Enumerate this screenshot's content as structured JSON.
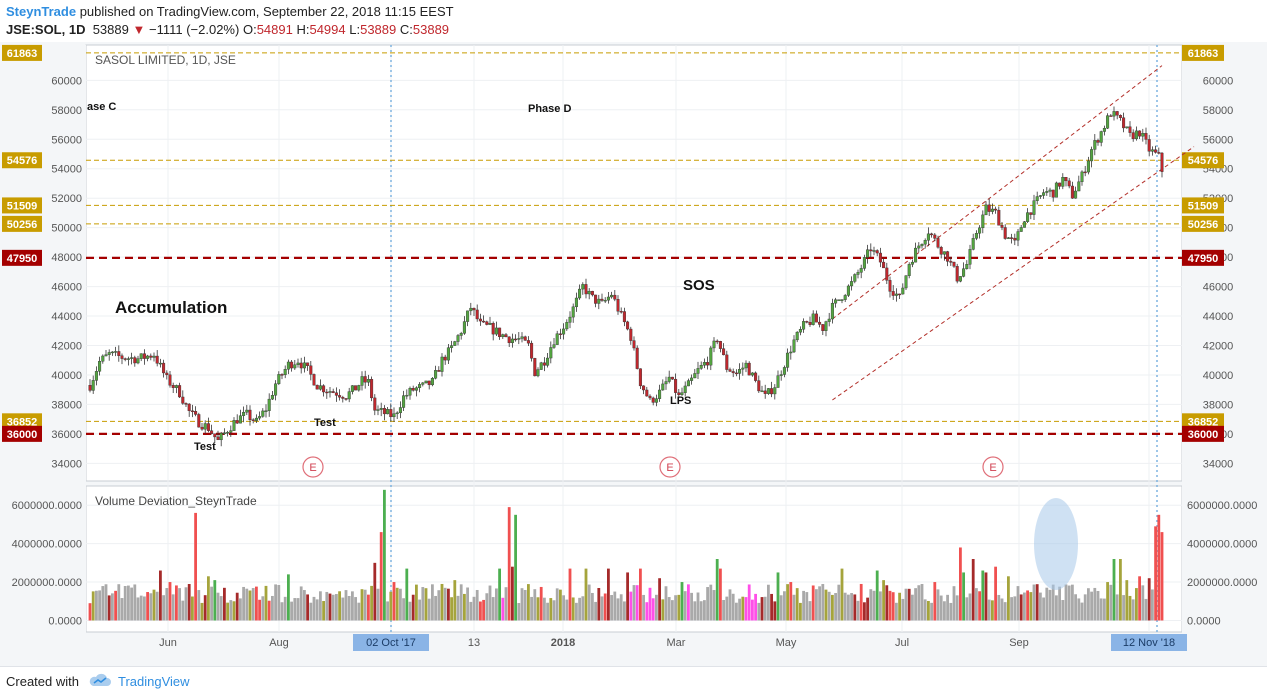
{
  "header": {
    "author": "SteynTrade",
    "published": " published on TradingView.com, September 22, 2018 11:15 EEST",
    "symbol": "JSE:SOL, 1D",
    "last": "53889",
    "change": "−1111 (−2.02%)",
    "o_label": "O:",
    "o_val": "54891",
    "h_label": "H:",
    "h_val": "54994",
    "l_label": "L:",
    "l_val": "53889",
    "c_label": "C:",
    "c_val": "53889"
  },
  "footer": {
    "created": "Created with",
    "brand": "TradingView"
  },
  "colors": {
    "up": "#53a540",
    "down": "#c0272d",
    "gold": "#c89c00",
    "darkred": "#a40000",
    "vol_grey": "#a9a9a9",
    "vol_olive": "#a5a43c",
    "vol_green": "#4caf50",
    "vol_darkred": "#a52a2a",
    "vol_red": "#f05050",
    "vol_pink": "#ff4fe8"
  },
  "chart_data": [
    {
      "type": "candlestick",
      "title": "SASOL LIMITED, 1D, JSE",
      "ylim": [
        32800,
        62400
      ],
      "y_ticks": [
        34000,
        36000,
        38000,
        40000,
        42000,
        44000,
        46000,
        48000,
        50000,
        52000,
        54000,
        56000,
        58000,
        60000
      ],
      "x_ticks": [
        "Jun",
        "Aug",
        "02 Oct '17",
        "13",
        "2018",
        "Mar",
        "May",
        "Jul",
        "Sep",
        "12 Nov '18"
      ],
      "x_ticks_highlighted": [
        "02 Oct '17",
        "12 Nov '18"
      ],
      "horizontal_levels": [
        {
          "value": 61863,
          "style": "gold-dashed"
        },
        {
          "value": 54576,
          "style": "gold-dashed"
        },
        {
          "value": 51509,
          "style": "gold-dashed"
        },
        {
          "value": 50256,
          "style": "gold-dashed"
        },
        {
          "value": 47950,
          "style": "darkred-thick-dashed"
        },
        {
          "value": 36852,
          "style": "gold-dashed"
        },
        {
          "value": 36000,
          "style": "darkred-thick-dashed"
        }
      ],
      "annotations": [
        {
          "text": "ase C"
        },
        {
          "text": "Phase D"
        },
        {
          "text": "Accumulation"
        },
        {
          "text": "SOS"
        },
        {
          "text": "LPS"
        },
        {
          "text": "Test"
        },
        {
          "text": "Test"
        }
      ],
      "event_markers": [
        "E",
        "E",
        "E"
      ],
      "price_path": [
        [
          0,
          39300
        ],
        [
          3,
          40900
        ],
        [
          6,
          41400
        ],
        [
          10,
          41200
        ],
        [
          15,
          41100
        ],
        [
          20,
          41400
        ],
        [
          24,
          39700
        ],
        [
          28,
          38800
        ],
        [
          31,
          37500
        ],
        [
          34,
          36800
        ],
        [
          37,
          36400
        ],
        [
          40,
          35500
        ],
        [
          43,
          36300
        ],
        [
          46,
          37000
        ],
        [
          49,
          37300
        ],
        [
          52,
          36800
        ],
        [
          55,
          37700
        ],
        [
          58,
          39400
        ],
        [
          62,
          40700
        ],
        [
          65,
          41000
        ],
        [
          68,
          40300
        ],
        [
          71,
          39300
        ],
        [
          74,
          39000
        ],
        [
          77,
          38800
        ],
        [
          80,
          38600
        ],
        [
          83,
          39100
        ],
        [
          85,
          39600
        ],
        [
          87,
          39500
        ],
        [
          89,
          37600
        ],
        [
          92,
          37400
        ],
        [
          95,
          37200
        ],
        [
          98,
          38500
        ],
        [
          101,
          39000
        ],
        [
          104,
          39200
        ],
        [
          107,
          39500
        ],
        [
          110,
          41000
        ],
        [
          113,
          41800
        ],
        [
          116,
          43000
        ],
        [
          119,
          44600
        ],
        [
          122,
          43400
        ],
        [
          125,
          43200
        ],
        [
          128,
          42800
        ],
        [
          131,
          42500
        ],
        [
          134,
          42400
        ],
        [
          137,
          42000
        ],
        [
          139,
          40200
        ],
        [
          142,
          41000
        ],
        [
          145,
          42400
        ],
        [
          148,
          43300
        ],
        [
          151,
          44500
        ],
        [
          154,
          46000
        ],
        [
          157,
          45200
        ],
        [
          160,
          44800
        ],
        [
          163,
          45500
        ],
        [
          166,
          44000
        ],
        [
          169,
          42600
        ],
        [
          172,
          39500
        ],
        [
          175,
          38200
        ],
        [
          178,
          38800
        ],
        [
          181,
          39800
        ],
        [
          184,
          38500
        ],
        [
          187,
          39300
        ],
        [
          190,
          40300
        ],
        [
          193,
          41000
        ],
        [
          196,
          42500
        ],
        [
          199,
          40500
        ],
        [
          202,
          40100
        ],
        [
          205,
          40700
        ],
        [
          208,
          39500
        ],
        [
          211,
          38500
        ],
        [
          214,
          39300
        ],
        [
          217,
          40800
        ],
        [
          220,
          42300
        ],
        [
          223,
          43300
        ],
        [
          226,
          43800
        ],
        [
          229,
          43200
        ],
        [
          232,
          44600
        ],
        [
          235,
          45400
        ],
        [
          238,
          46200
        ],
        [
          241,
          47300
        ],
        [
          244,
          48600
        ],
        [
          247,
          47700
        ],
        [
          250,
          46000
        ],
        [
          253,
          45200
        ],
        [
          256,
          47600
        ],
        [
          259,
          48800
        ],
        [
          262,
          49800
        ],
        [
          265,
          48800
        ],
        [
          268,
          48000
        ],
        [
          271,
          46600
        ],
        [
          274,
          47500
        ],
        [
          277,
          49700
        ],
        [
          280,
          51300
        ],
        [
          283,
          51000
        ],
        [
          286,
          49500
        ],
        [
          289,
          48900
        ],
        [
          292,
          50700
        ],
        [
          295,
          51500
        ],
        [
          298,
          52400
        ],
        [
          301,
          52400
        ],
        [
          304,
          53300
        ],
        [
          307,
          52200
        ],
        [
          310,
          53500
        ],
        [
          313,
          55300
        ],
        [
          316,
          56500
        ],
        [
          319,
          57800
        ],
        [
          322,
          57200
        ],
        [
          325,
          56200
        ],
        [
          328,
          56500
        ],
        [
          331,
          55300
        ],
        [
          334,
          54800
        ],
        [
          335,
          53889
        ]
      ],
      "channel": {
        "upper": [
          [
            232,
            43800
          ],
          [
            335,
            61000
          ]
        ],
        "lower": [
          [
            232,
            38300
          ],
          [
            345,
            55500
          ]
        ]
      }
    },
    {
      "type": "bar",
      "title": "Volume Deviation_SteynTrade",
      "ylim": [
        -600000,
        7000000
      ],
      "y_ticks": [
        0,
        2000000,
        4000000,
        6000000
      ],
      "y_tick_labels": [
        "0.0000",
        "2000000.0000",
        "4000000.0000",
        "6000000.0000"
      ],
      "spikes": [
        [
          22,
          2600000,
          "vol_darkred"
        ],
        [
          25,
          2000000,
          "vol_red"
        ],
        [
          33,
          5600000,
          "vol_red"
        ],
        [
          37,
          2300000,
          "vol_olive"
        ],
        [
          39,
          2100000,
          "vol_green"
        ],
        [
          42,
          1700000,
          "vol_darkred"
        ],
        [
          55,
          1800000,
          "vol_olive"
        ],
        [
          62,
          2400000,
          "vol_green"
        ],
        [
          75,
          1400000,
          "vol_darkred"
        ],
        [
          88,
          1800000,
          "vol_olive"
        ],
        [
          89,
          3000000,
          "vol_darkred"
        ],
        [
          91,
          4600000,
          "vol_red"
        ],
        [
          92,
          6800000,
          "vol_green"
        ],
        [
          95,
          2000000,
          "vol_red"
        ],
        [
          99,
          2700000,
          "vol_green"
        ],
        [
          110,
          1900000,
          "vol_olive"
        ],
        [
          114,
          2100000,
          "vol_olive"
        ],
        [
          128,
          2700000,
          "vol_green"
        ],
        [
          131,
          5900000,
          "vol_red"
        ],
        [
          133,
          5500000,
          "vol_green"
        ],
        [
          132,
          2800000,
          "vol_darkred"
        ],
        [
          150,
          2700000,
          "vol_red"
        ],
        [
          155,
          2700000,
          "vol_olive"
        ],
        [
          162,
          2700000,
          "vol_darkred"
        ],
        [
          168,
          2500000,
          "vol_darkred"
        ],
        [
          172,
          2700000,
          "vol_red"
        ],
        [
          178,
          2200000,
          "vol_darkred"
        ],
        [
          185,
          2000000,
          "vol_green"
        ],
        [
          196,
          3200000,
          "vol_green"
        ],
        [
          197,
          2700000,
          "vol_red"
        ],
        [
          215,
          2500000,
          "vol_green"
        ],
        [
          219,
          2000000,
          "vol_red"
        ],
        [
          235,
          2700000,
          "vol_olive"
        ],
        [
          241,
          1900000,
          "vol_red"
        ],
        [
          246,
          2600000,
          "vol_green"
        ],
        [
          248,
          2100000,
          "vol_olive"
        ],
        [
          264,
          2000000,
          "vol_red"
        ],
        [
          272,
          3800000,
          "vol_red"
        ],
        [
          273,
          2500000,
          "vol_green"
        ],
        [
          276,
          3200000,
          "vol_darkred"
        ],
        [
          279,
          2600000,
          "vol_green"
        ],
        [
          280,
          2500000,
          "vol_darkred"
        ],
        [
          283,
          2800000,
          "vol_red"
        ],
        [
          287,
          2300000,
          "vol_olive"
        ],
        [
          318,
          2000000,
          "vol_olive"
        ],
        [
          320,
          3200000,
          "vol_green"
        ],
        [
          322,
          3200000,
          "vol_olive"
        ],
        [
          324,
          2100000,
          "vol_olive"
        ],
        [
          328,
          2300000,
          "vol_red"
        ],
        [
          331,
          2200000,
          "vol_darkred"
        ],
        [
          333,
          4900000,
          "vol_red"
        ],
        [
          334,
          5500000,
          "vol_red"
        ],
        [
          335,
          4600000,
          "vol_red"
        ]
      ]
    }
  ]
}
